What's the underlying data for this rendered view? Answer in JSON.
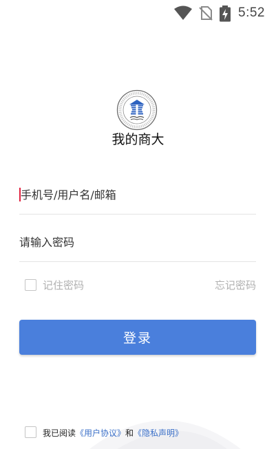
{
  "status_bar": {
    "time": "5:52",
    "icons": [
      "wifi-icon",
      "no-sim-icon",
      "battery-charging-icon"
    ]
  },
  "app": {
    "logo": "university-seal-logo",
    "title": "我的商大"
  },
  "login_form": {
    "username_placeholder": "手机号/用户名/邮箱",
    "password_placeholder": "请输入密码",
    "remember_label": "记住密码",
    "remember_checked": false,
    "forgot_label": "忘记密码",
    "submit_label": "登录"
  },
  "agreement": {
    "prefix": "我已阅读",
    "user_agreement": "《用户协议》",
    "conjunction": "和",
    "privacy_policy": "《隐私声明》",
    "checked": false
  },
  "colors": {
    "accent": "#4a7fdc",
    "link": "#3a6fc8",
    "muted": "#b0b0b0",
    "cursor": "#e0203e"
  }
}
